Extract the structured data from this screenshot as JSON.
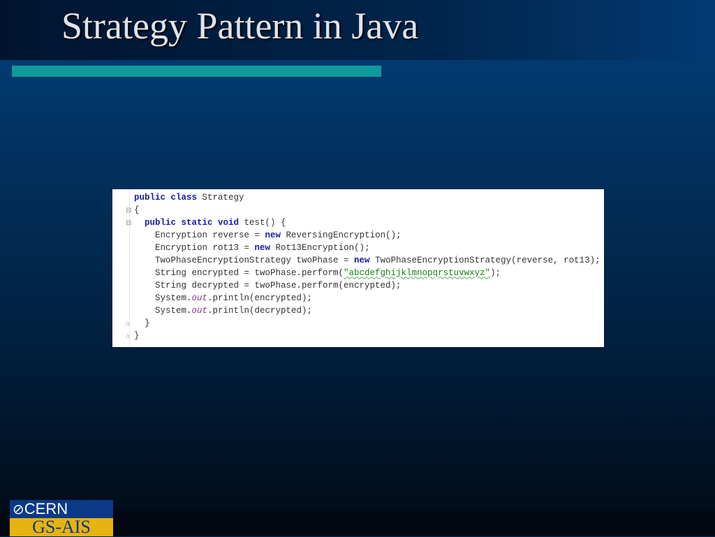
{
  "slide": {
    "title": "Strategy Pattern in Java"
  },
  "code": {
    "lines": [
      {
        "indent": 0,
        "parts": [
          [
            "kw",
            "public class"
          ],
          [
            "",
            "Strategy"
          ]
        ]
      },
      {
        "indent": 0,
        "parts": [
          [
            "",
            "{"
          ]
        ]
      },
      {
        "indent": 1,
        "parts": [
          [
            "kw",
            "public static void"
          ],
          [
            "",
            "test() {"
          ]
        ]
      },
      {
        "indent": 2,
        "parts": [
          [
            "",
            "Encryption reverse = "
          ],
          [
            "kw",
            "new"
          ],
          [
            "",
            " ReversingEncryption();"
          ]
        ]
      },
      {
        "indent": 2,
        "parts": [
          [
            "",
            "Encryption rot13 = "
          ],
          [
            "kw",
            "new"
          ],
          [
            "",
            " Rot13Encryption();"
          ]
        ]
      },
      {
        "indent": 2,
        "parts": [
          [
            "",
            "TwoPhaseEncryptionStrategy twoPhase = "
          ],
          [
            "kw",
            "new"
          ],
          [
            "",
            " TwoPhaseEncryptionStrategy(reverse, rot13);"
          ]
        ]
      },
      {
        "indent": 2,
        "parts": [
          [
            "",
            "String encrypted = twoPhase.perform("
          ],
          [
            "str",
            "\"abcdefghijklmnopqrstuvwxyz\""
          ],
          [
            "",
            ");"
          ]
        ]
      },
      {
        "indent": 2,
        "parts": [
          [
            "",
            "String decrypted = twoPhase.perform(encrypted);"
          ]
        ]
      },
      {
        "indent": 2,
        "parts": [
          [
            "",
            "System."
          ],
          [
            "st",
            "out"
          ],
          [
            "",
            ".println(encrypted);"
          ]
        ]
      },
      {
        "indent": 2,
        "parts": [
          [
            "",
            "System."
          ],
          [
            "st",
            "out"
          ],
          [
            "",
            ".println(decrypted);"
          ]
        ]
      },
      {
        "indent": 1,
        "parts": [
          [
            "",
            "}"
          ]
        ]
      },
      {
        "indent": 0,
        "parts": [
          [
            "",
            "}"
          ]
        ]
      }
    ]
  },
  "logo": {
    "top": "CERN",
    "bottom": "GS-AIS"
  }
}
